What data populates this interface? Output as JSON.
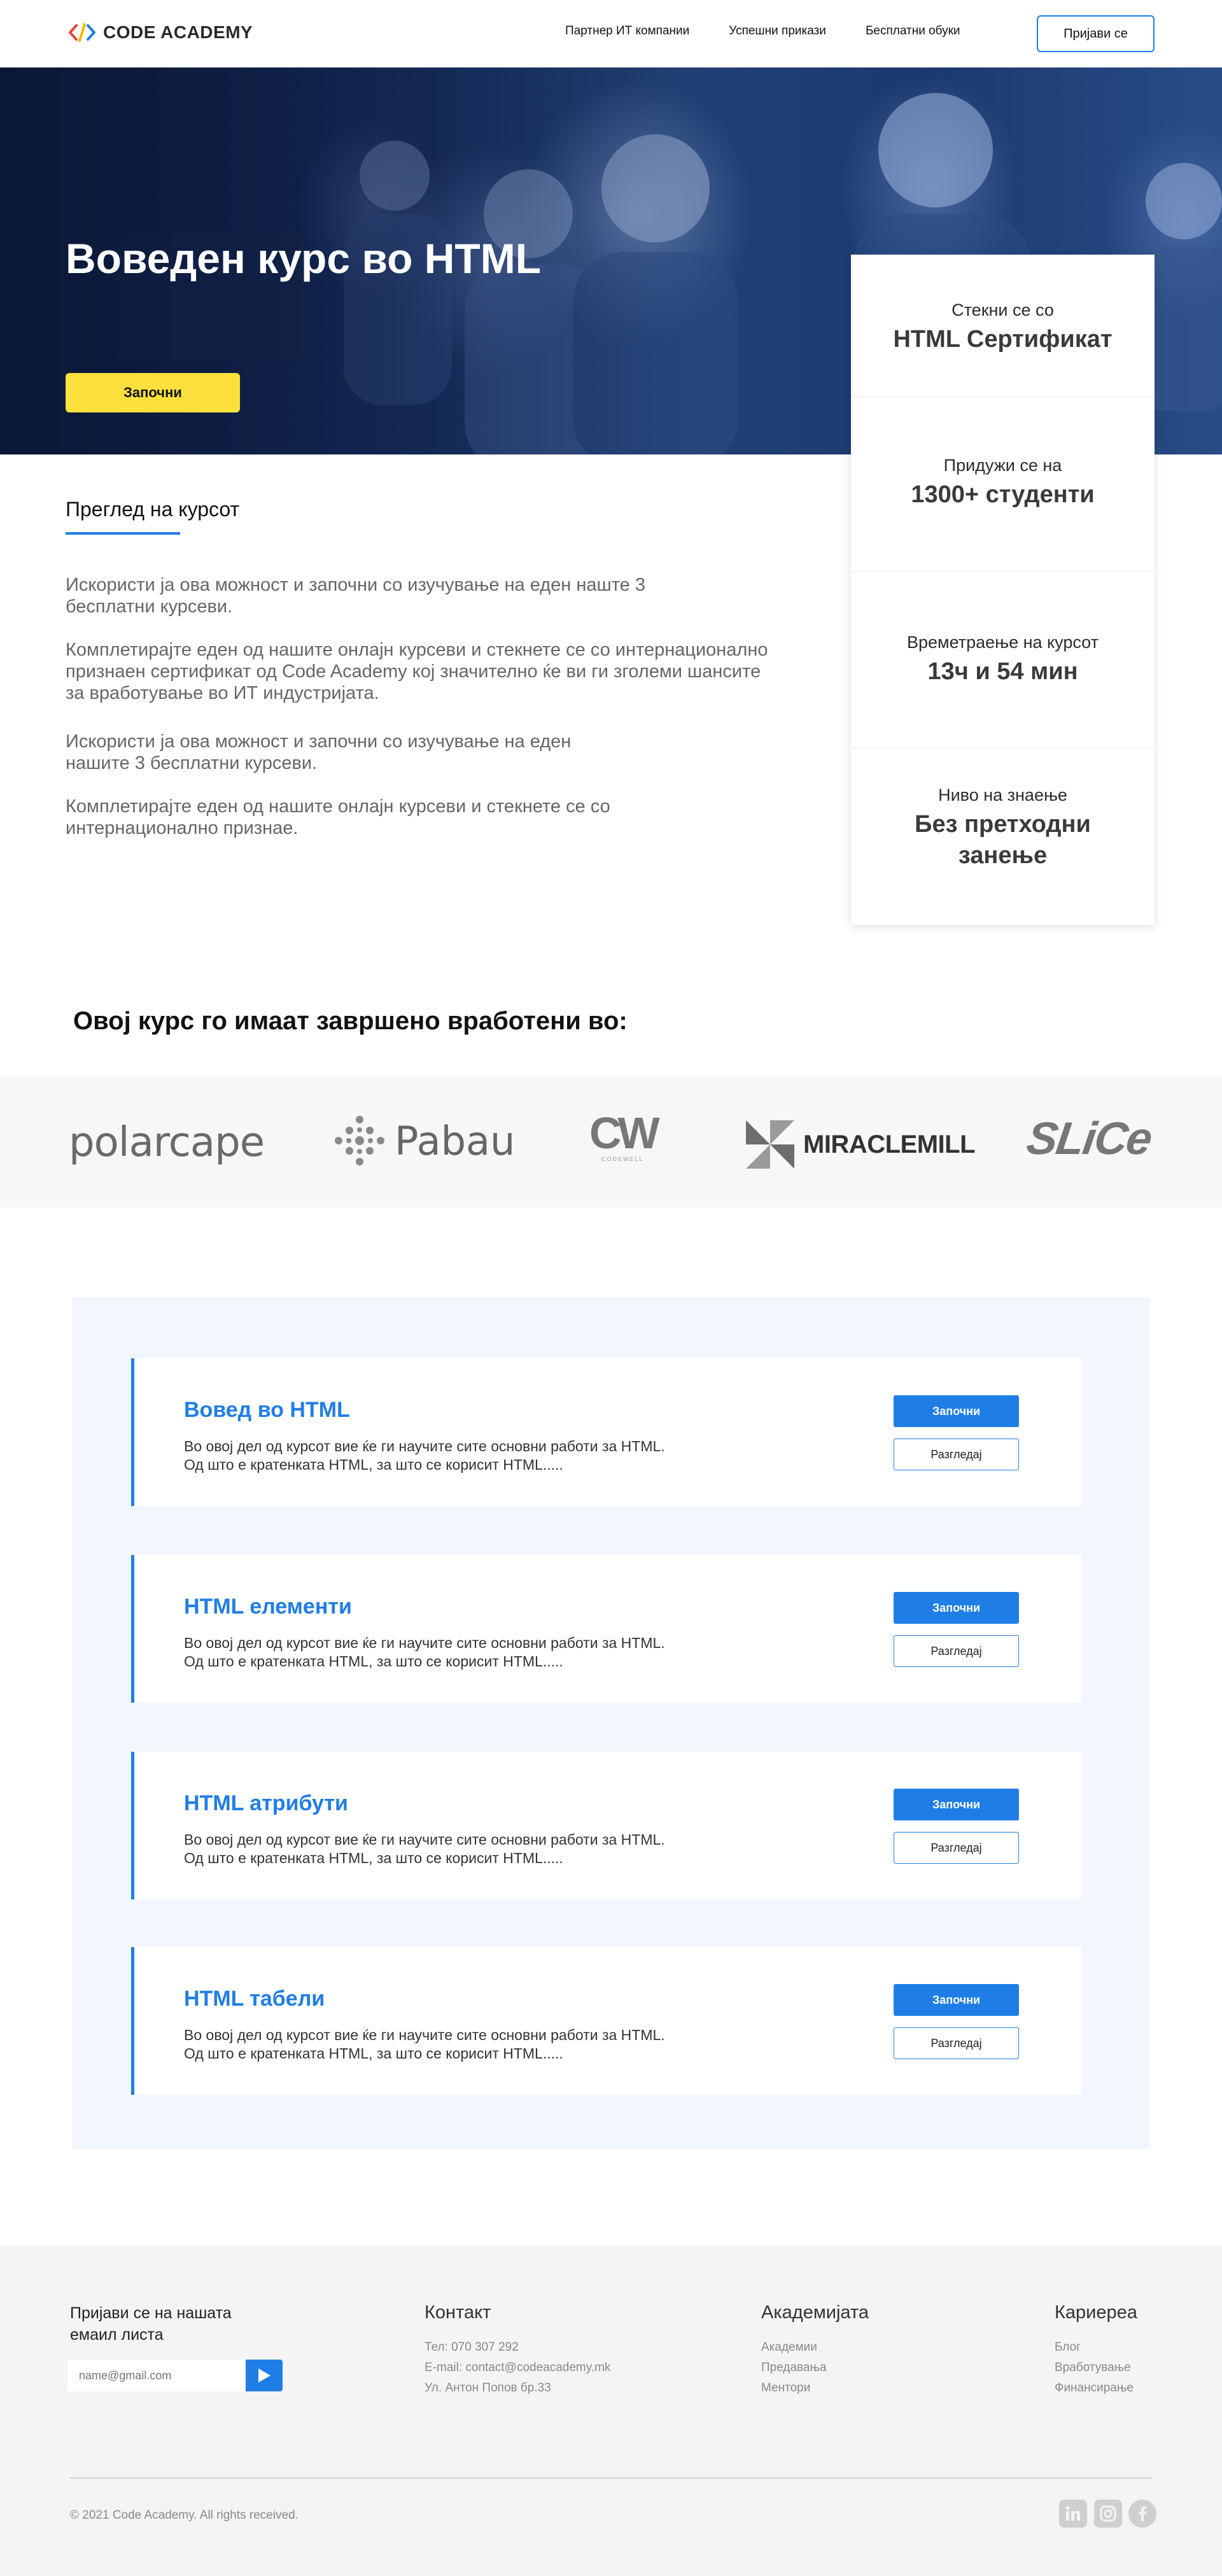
{
  "brand": {
    "name": "CODE ACADEMY",
    "colors": {
      "primary": "#1f7ee6",
      "accent": "#fde03b"
    }
  },
  "nav": {
    "links": [
      "Партнер ИТ компании",
      "Успешни прикази",
      "Бесплатни обуки"
    ],
    "login": "Пријави се"
  },
  "hero": {
    "title": "Воведен курс во HTML",
    "cta": "Започни"
  },
  "stats": [
    {
      "label": "Стекни се со",
      "value": "HTML Сертификат"
    },
    {
      "label": "Придужи се на",
      "value": "1300+ студенти"
    },
    {
      "label": "Времетраење на курсот",
      "value": "13ч и 54 мин"
    },
    {
      "label": "Ниво на знаење",
      "value": "Без претходни занење"
    }
  ],
  "overview": {
    "heading": "Преглед на курсот",
    "paragraphs": [
      "Искористи ја ова можност и започни со изучување на еден наште 3 бесплатни курсеви.",
      "Комплетирајте еден од нашите онлајн курсеви и стекнете се со интернационално признаен сертификат од Code Academy кој значително ќе ви ги зголеми шансите за вработување во ИТ индустријата.",
      "Искористи ја ова можност и започни со изучување на еден нашите 3 бесплатни курсеви.",
      "Комплетирајте еден од нашите онлајн курсеви и стекнете се со интернационално признае."
    ]
  },
  "employed": {
    "heading": "Овој курс го имаат завршено вработени во:",
    "companies": [
      "polarcape",
      "Pabau",
      "CW",
      "MIRACLEMILL",
      "SLiCe"
    ],
    "cw_sub": "CODEWELL"
  },
  "lessons": [
    {
      "title": "Вовед во HTML",
      "desc1": "Во овој дел од курсот вие ќе ги научите сите основни работи за HTML.",
      "desc2": "Од што е кратенката HTML, за што се корисит HTML.....",
      "start": "Започни",
      "view": "Разгледај"
    },
    {
      "title": "HTML елементи",
      "desc1": "Во овој дел од курсот вие ќе ги научите сите основни работи за HTML.",
      "desc2": "Од што е кратенката HTML, за што се корисит HTML.....",
      "start": "Започни",
      "view": "Разгледај"
    },
    {
      "title": "HTML атрибути",
      "desc1": "Во овој дел од курсот вие ќе ги научите сите основни работи за HTML.",
      "desc2": "Од што е кратенката HTML, за што се корисит HTML.....",
      "start": "Започни",
      "view": "Разгледај"
    },
    {
      "title": "HTML табели",
      "desc1": "Во овој дел од курсот вие ќе ги научите сите основни работи за HTML.",
      "desc2": "Од што е кратенката HTML, за што се корисит HTML.....",
      "start": "Започни",
      "view": "Разгледај"
    }
  ],
  "footer": {
    "newsletter": "Пријави се на нашата емаил листа",
    "email_placeholder": "name@gmail.com",
    "contact": {
      "title": "Контакт",
      "items": [
        "Тел: 070 307 292",
        "E-mail: contact@codeacademy.mk",
        "Ул. Антон Попов бр.33"
      ]
    },
    "academy": {
      "title": "Академијата",
      "items": [
        "Академии",
        "Предавања",
        "Ментори"
      ]
    },
    "career": {
      "title": "Кариереа",
      "items": [
        "Блог",
        "Вработување",
        "Финансирање"
      ]
    },
    "copyright": "© 2021 Code Academy. All rights received.",
    "social": [
      "linkedin-icon",
      "instagram-icon",
      "facebook-icon"
    ]
  }
}
